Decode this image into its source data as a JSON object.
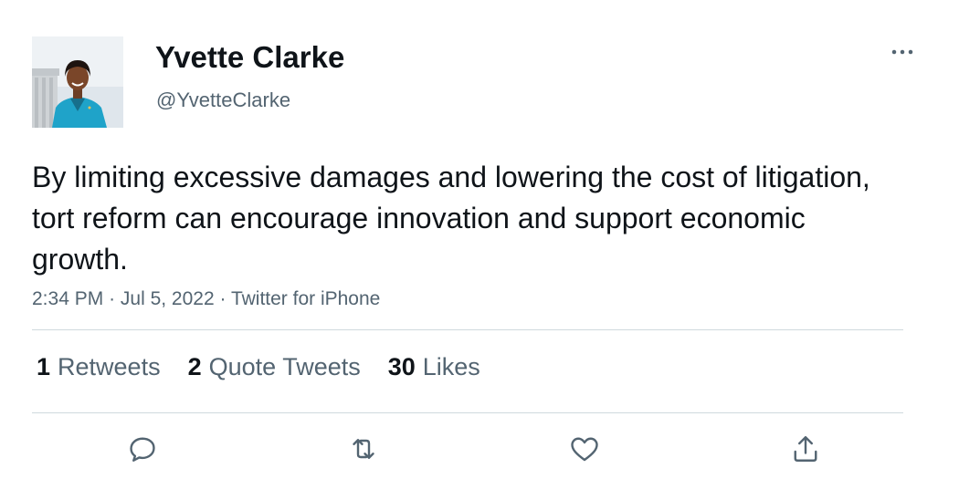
{
  "author": {
    "display_name": "Yvette Clarke",
    "handle": "@YvetteClarke"
  },
  "tweet": {
    "text": "By limiting excessive damages and lowering the cost of litigation, tort reform can encourage innovation and support economic growth.",
    "time": "2:34 PM",
    "separator": "·",
    "date": "Jul 5, 2022",
    "source": "Twitter for iPhone"
  },
  "stats": {
    "retweets_count": "1",
    "retweets_label": "Retweets",
    "quotes_count": "2",
    "quotes_label": "Quote Tweets",
    "likes_count": "30",
    "likes_label": "Likes"
  },
  "icons": {
    "more": "more-icon",
    "reply": "reply-icon",
    "retweet": "retweet-icon",
    "like": "heart-icon",
    "share": "share-icon"
  },
  "colors": {
    "text_primary": "#0f1419",
    "text_secondary": "#536471",
    "divider": "#cfd9de",
    "avatar_jacket": "#1fa3c9"
  }
}
